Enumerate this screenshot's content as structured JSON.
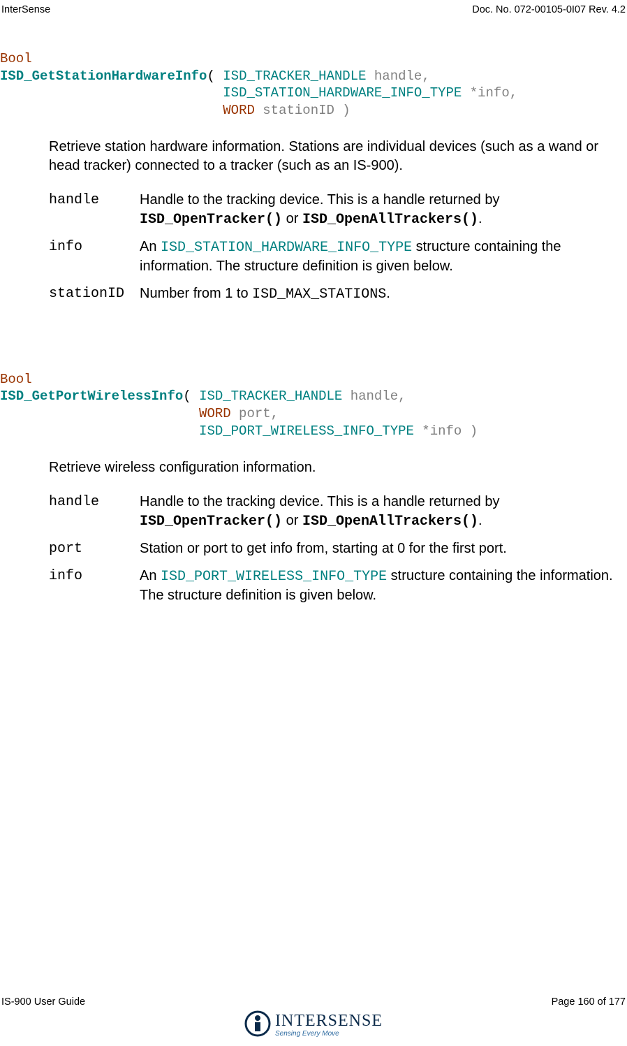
{
  "header": {
    "left": "InterSense",
    "right": "Doc. No. 072-00105-0I07 Rev. 4.2"
  },
  "func1": {
    "ret": "Bool",
    "name": "ISD_GetStationHardwareInfo",
    "p1_type": "ISD_TRACKER_HANDLE",
    "p1_name": " handle,",
    "p2_type": "ISD_STATION_HARDWARE_INFO_TYPE",
    "p2_name": " *info,",
    "p3_type": "WORD",
    "p3_name": " stationID )",
    "desc": "Retrieve station hardware information.  Stations are individual devices (such as a wand or head tracker) connected to a tracker (such as an IS-900).",
    "params": {
      "handle": {
        "name": "handle",
        "t1": "Handle to the tracking device.  This is a handle returned by ",
        "c1": "ISD_OpenTracker()",
        "t2": " or ",
        "c2": "ISD_OpenAllTrackers()",
        "t3": "."
      },
      "info": {
        "name": "info",
        "t1": "An ",
        "c1": "ISD_STATION_HARDWARE_INFO_TYPE",
        "t2": " structure containing the information.  The structure definition is given below."
      },
      "stationID": {
        "name": "stationID",
        "t1": "Number from 1 to ",
        "c1": "ISD_MAX_STATIONS",
        "t2": "."
      }
    }
  },
  "func2": {
    "ret": "Bool",
    "name": "ISD_GetPortWirelessInfo",
    "p1_type": "ISD_TRACKER_HANDLE",
    "p1_name": " handle,",
    "p2_type": "WORD",
    "p2_name": " port,",
    "p3_type": "ISD_PORT_WIRELESS_INFO_TYPE",
    "p3_name": " *info )",
    "desc": "Retrieve wireless configuration information.",
    "params": {
      "handle": {
        "name": "handle",
        "t1": "Handle to the tracking device.  This is a handle returned by ",
        "c1": "ISD_OpenTracker()",
        "t2": " or ",
        "c2": "ISD_OpenAllTrackers()",
        "t3": "."
      },
      "port": {
        "name": "port",
        "t1": "Station or port to get info from, starting at 0 for the first port."
      },
      "info": {
        "name": "info",
        "t1": "An ",
        "c1": "ISD_PORT_WIRELESS_INFO_TYPE",
        "t2": " structure containing the information.  The structure definition is given below."
      }
    }
  },
  "footer": {
    "left": "IS-900 User Guide",
    "right": "Page 160 of 177",
    "logo_main": "INTERSENSE",
    "logo_tag": "Sensing Every Move"
  }
}
